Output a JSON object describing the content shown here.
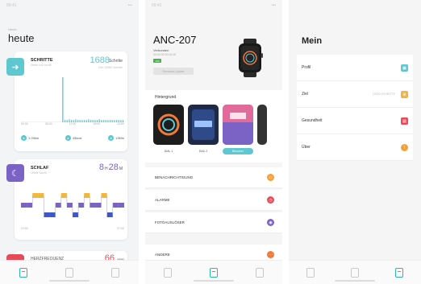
{
  "screen1": {
    "status": {
      "left": "09:41",
      "right": "•••"
    },
    "eyebrow": "Heute",
    "title": "heute",
    "steps": {
      "label": "SCHRITTE",
      "sub": "Daten von heute",
      "value": "1688",
      "unit": "Schritte",
      "right_sub": "Ziel: 10000 Schritte",
      "ticks": [
        "00:00",
        "06:00",
        "12:00",
        "18:00",
        "23:59"
      ],
      "metrics": [
        {
          "icon": "distance-icon",
          "value": "1.03km"
        },
        {
          "icon": "calorie-icon",
          "value": "43kcal"
        },
        {
          "icon": "time-icon",
          "value": "13Min"
        }
      ]
    },
    "sleep": {
      "label": "SCHLAF",
      "sub": "Letzte Nacht",
      "hours": "8",
      "h": "H",
      "minutes": "28",
      "m": "M",
      "ticks": [
        "22:00",
        "07:00"
      ]
    },
    "heart": {
      "label": "HERZFREQUENZ",
      "value": "66",
      "unit": "BPM"
    },
    "colors": {
      "steps": "#5fc7cf",
      "sleep": "#7b63c6",
      "heart": "#e84a5a"
    }
  },
  "screen2": {
    "status": {
      "left": "09:41",
      "right": "•••"
    },
    "device_name": "ANC-207",
    "device_status": "Verbunden",
    "device_mac": "00:00:00:00:00:00",
    "battery": "100",
    "update_button": "Firmware-Update",
    "background_label": "Hintergrund",
    "faces": [
      "DIAL 1",
      "DIAL 2",
      "Benutzer"
    ],
    "rows": [
      {
        "label": "BENACHRICHTIGUNG",
        "icon": "message-icon",
        "color": "#f2a03d"
      },
      {
        "label": "ALARME",
        "icon": "alarm-icon",
        "color": "#e84a5a"
      },
      {
        "label": "FOTOAUSLÖSER",
        "icon": "camera-icon",
        "color": "#7b63c6"
      },
      {
        "label": "ANDERE",
        "icon": "more-icon",
        "color": "#f07a3a"
      }
    ]
  },
  "screen3": {
    "status": {
      "left": "09:41",
      "right": "•••"
    },
    "title": "Mein",
    "items": [
      {
        "label": "Profil",
        "extra": "",
        "icon": "profile-icon",
        "color": "#5fc7cf"
      },
      {
        "label": "Ziel",
        "extra": "10000 SCHRITTE",
        "icon": "trophy-icon",
        "color": "#f2b53d"
      },
      {
        "label": "Gesundheit",
        "extra": "",
        "icon": "health-icon",
        "color": "#e84a5a"
      },
      {
        "label": "Über",
        "extra": "",
        "icon": "info-icon",
        "color": "#f2a03d"
      }
    ]
  },
  "chart_data": [
    {
      "type": "bar",
      "title": "",
      "series": [
        {
          "values": [
            0,
            0,
            0,
            0,
            0,
            0,
            0,
            0,
            0,
            0,
            0,
            0,
            0,
            0,
            0,
            0,
            0,
            0,
            0,
            60,
            3,
            3,
            4,
            3,
            3,
            4,
            3,
            3,
            3,
            3,
            3,
            4,
            3,
            3,
            3,
            3,
            4,
            3,
            3,
            3,
            3,
            3,
            3,
            3,
            3,
            3,
            3,
            3
          ]
        }
      ]
    },
    {
      "type": "bar",
      "title": "",
      "series": [
        {
          "values": [
            2,
            2,
            1,
            1,
            3,
            3,
            2,
            1,
            2,
            3,
            2,
            1,
            2,
            2,
            1,
            3,
            2,
            2
          ]
        }
      ]
    }
  ]
}
